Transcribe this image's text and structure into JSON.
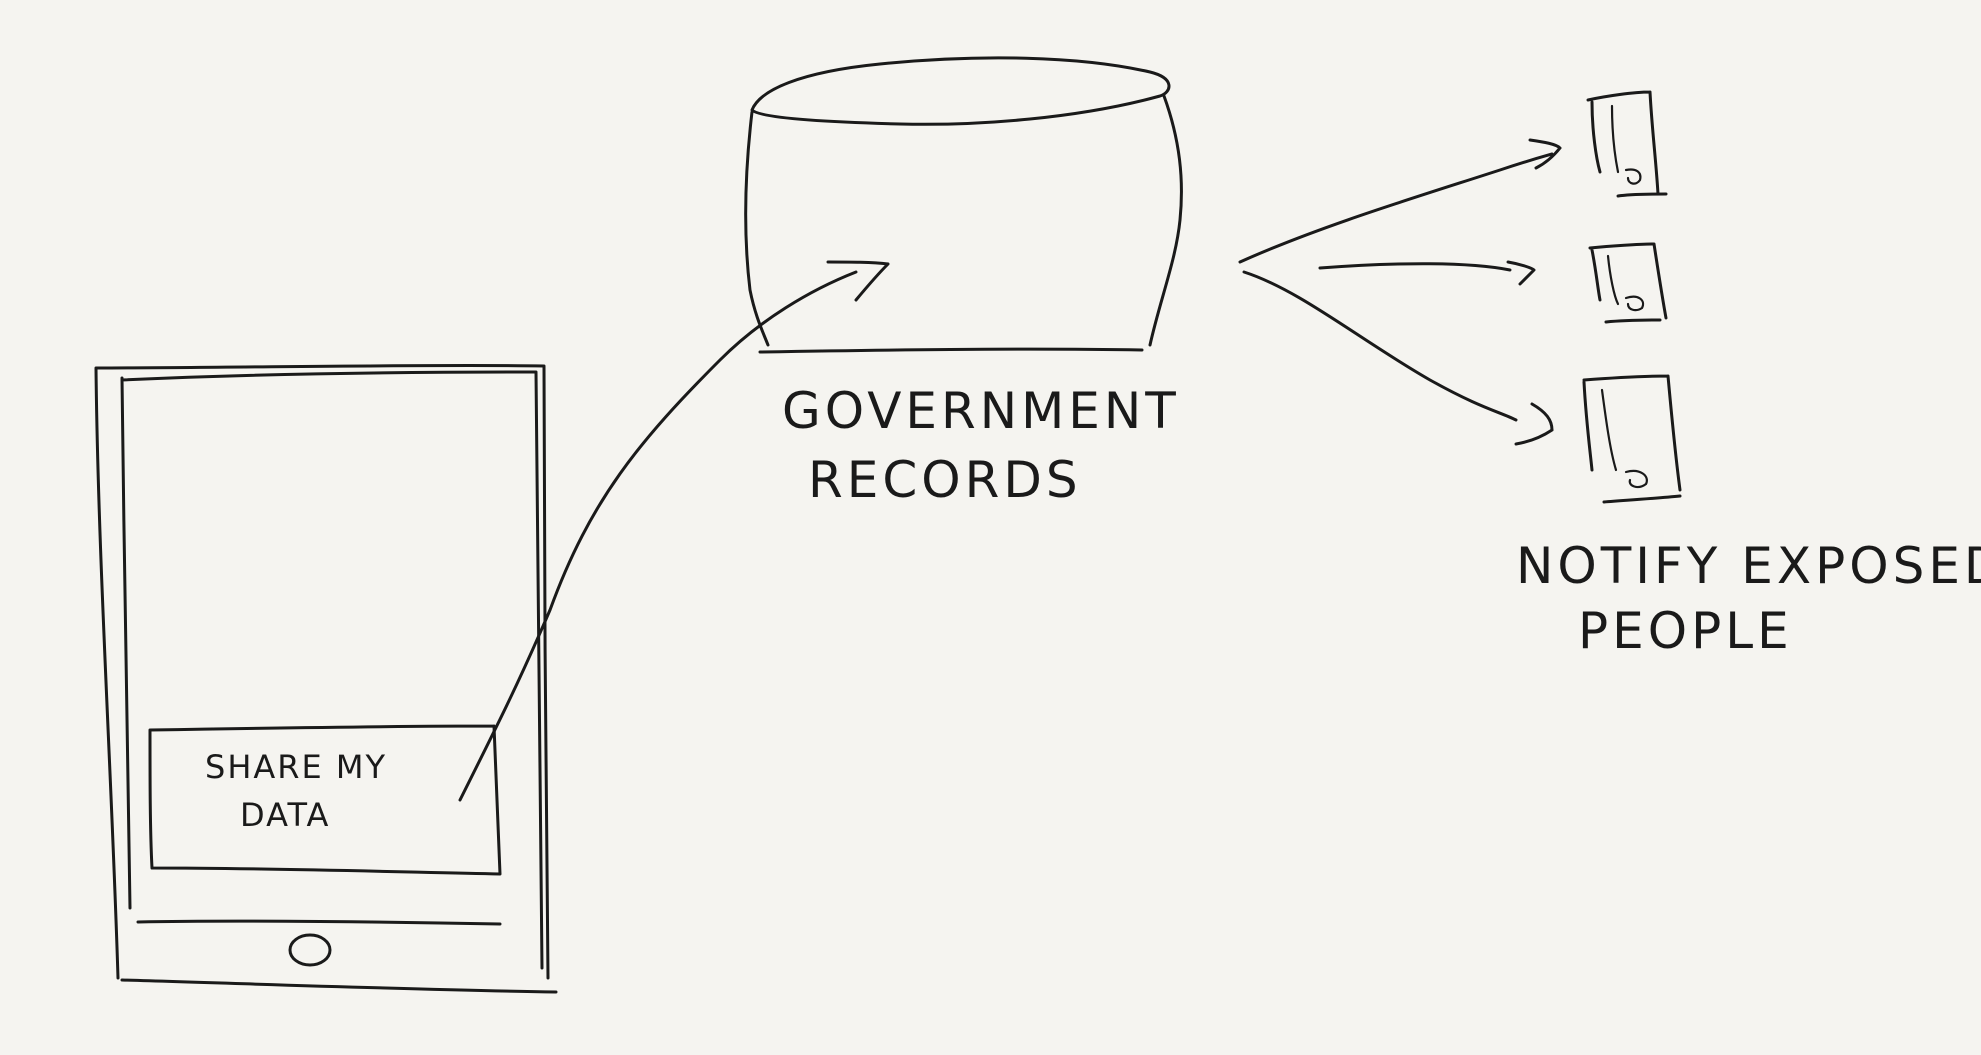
{
  "diagram": {
    "phone_button": {
      "line1": "SHARE MY",
      "line2": "DATA"
    },
    "database": {
      "line1": "GOVERNMENT",
      "line2": "RECORDS"
    },
    "recipients": {
      "line1": "NOTIFY EXPOSED",
      "line2": "PEOPLE"
    }
  }
}
